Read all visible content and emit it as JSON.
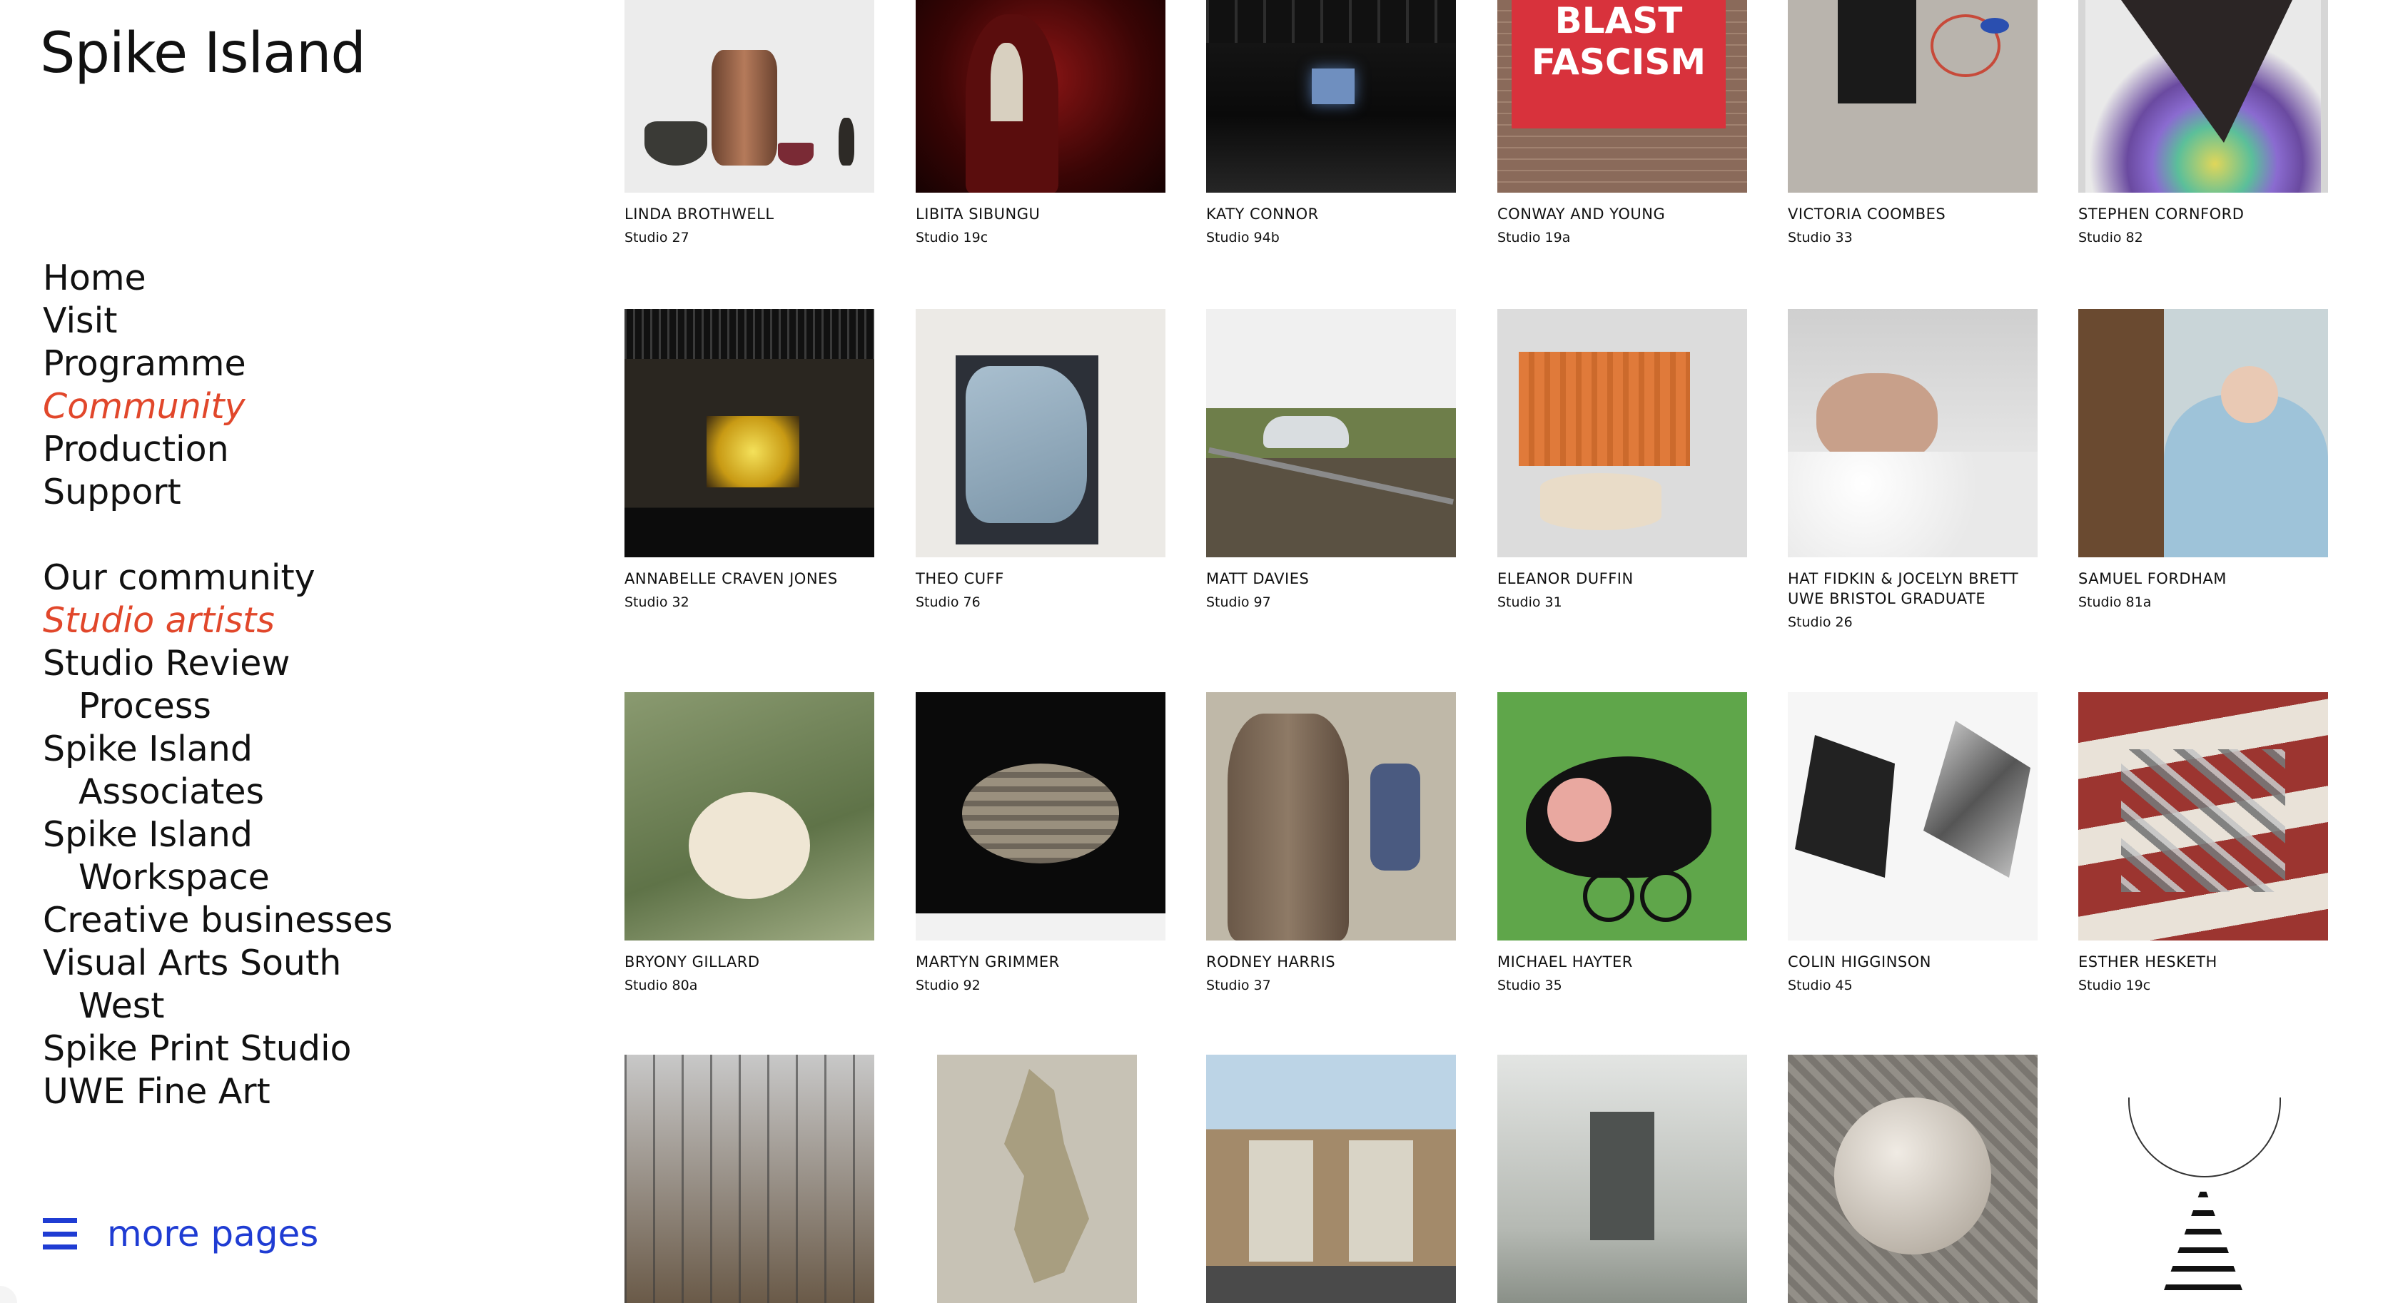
{
  "site": {
    "title": "Spike Island"
  },
  "nav_main": [
    {
      "label": "Home",
      "active": false
    },
    {
      "label": "Visit",
      "active": false
    },
    {
      "label": "Programme",
      "active": false
    },
    {
      "label": "Community",
      "active": true
    },
    {
      "label": "Production",
      "active": false
    },
    {
      "label": "Support",
      "active": false
    }
  ],
  "nav_sub": [
    {
      "label": "Our community",
      "indent": false,
      "active": false
    },
    {
      "label": "Studio artists",
      "indent": false,
      "active": true
    },
    {
      "label": "Studio Review",
      "indent": false,
      "active": false
    },
    {
      "label": "Process",
      "indent": true,
      "active": false
    },
    {
      "label": "Spike Island",
      "indent": false,
      "active": false
    },
    {
      "label": "Associates",
      "indent": true,
      "active": false
    },
    {
      "label": "Spike Island",
      "indent": false,
      "active": false
    },
    {
      "label": "Workspace",
      "indent": true,
      "active": false
    },
    {
      "label": "Creative businesses",
      "indent": false,
      "active": false
    },
    {
      "label": "Visual Arts South",
      "indent": false,
      "active": false
    },
    {
      "label": "West",
      "indent": true,
      "active": false
    },
    {
      "label": "Spike Print Studio",
      "indent": false,
      "active": false
    },
    {
      "label": "UWE Fine Art",
      "indent": false,
      "active": false
    }
  ],
  "more": {
    "label": "more pages",
    "icon": "hamburger-menu-icon"
  },
  "colors": {
    "accent": "#e1472b",
    "link": "#1f3cd3"
  },
  "artists": [
    {
      "name": "Linda Brothwell",
      "studio": "Studio 27"
    },
    {
      "name": "Libita Sibungu",
      "studio": "Studio 19c"
    },
    {
      "name": "Katy Connor",
      "studio": "Studio 94b"
    },
    {
      "name": "Conway and Young",
      "studio": "Studio 19a",
      "image_text": "BLAST\nFASCISM"
    },
    {
      "name": "Victoria Coombes",
      "studio": "Studio 33"
    },
    {
      "name": "Stephen Cornford",
      "studio": "Studio 82"
    },
    {
      "name": "Annabelle Craven Jones",
      "studio": "Studio 32"
    },
    {
      "name": "Theo Cuff",
      "studio": "Studio 76"
    },
    {
      "name": "Matt Davies",
      "studio": "Studio 97"
    },
    {
      "name": "Eleanor Duffin",
      "studio": "Studio 31"
    },
    {
      "name": "Hat Fidkin & Jocelyn Brett UWE Bristol Graduate",
      "studio": "Studio 26"
    },
    {
      "name": "Samuel Fordham",
      "studio": "Studio 81a"
    },
    {
      "name": "Bryony Gillard",
      "studio": "Studio 80a"
    },
    {
      "name": "Martyn Grimmer",
      "studio": "Studio 92"
    },
    {
      "name": "Rodney Harris",
      "studio": "Studio 37"
    },
    {
      "name": "Michael Hayter",
      "studio": "Studio 35"
    },
    {
      "name": "Colin Higginson",
      "studio": "Studio 45"
    },
    {
      "name": "Esther Hesketh",
      "studio": "Studio 19c"
    },
    {
      "name": "",
      "studio": ""
    },
    {
      "name": "",
      "studio": ""
    },
    {
      "name": "",
      "studio": ""
    },
    {
      "name": "",
      "studio": ""
    },
    {
      "name": "",
      "studio": ""
    },
    {
      "name": "",
      "studio": ""
    }
  ]
}
